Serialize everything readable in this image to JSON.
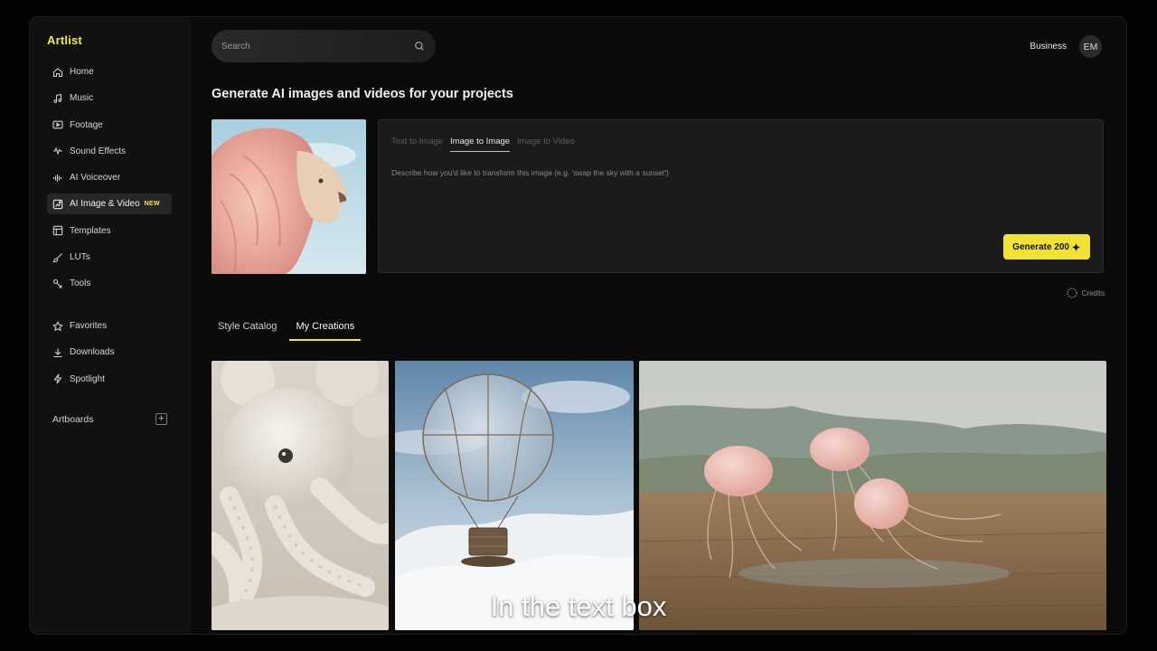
{
  "app": {
    "logo": "Artlist"
  },
  "sidebar": {
    "items": [
      {
        "label": "Home",
        "icon": "home-icon"
      },
      {
        "label": "Music",
        "icon": "music-note-icon"
      },
      {
        "label": "Footage",
        "icon": "play-icon"
      },
      {
        "label": "Sound Effects",
        "icon": "waveform-icon"
      },
      {
        "label": "AI Voiceover",
        "icon": "voice-wave-icon"
      },
      {
        "label": "AI Image & Video",
        "icon": "ai-image-icon",
        "badge": "NEW",
        "active": true
      },
      {
        "label": "Templates",
        "icon": "template-icon"
      },
      {
        "label": "LUTs",
        "icon": "brush-icon"
      },
      {
        "label": "Tools",
        "icon": "tools-icon"
      }
    ],
    "secondary": [
      {
        "label": "Favorites",
        "icon": "star-icon"
      },
      {
        "label": "Downloads",
        "icon": "download-icon"
      },
      {
        "label": "Spotlight",
        "icon": "bolt-icon"
      }
    ],
    "artboards_label": "Artboards"
  },
  "search": {
    "placeholder": "Search"
  },
  "header": {
    "business_label": "Business",
    "avatar_initials": "EM"
  },
  "main": {
    "heading": "Generate AI images and videos for your projects",
    "modes": [
      "Text to Image",
      "Image to Image",
      "Image to Video"
    ],
    "active_mode": "Image to Image",
    "prompt_placeholder": "Describe how you'd like to transform this image (e.g. 'swap the sky with a sunset')",
    "generate_label": "Generate 200",
    "credits_label": "Credits",
    "tabs": [
      "Style Catalog",
      "My Creations"
    ],
    "active_tab": "My Creations"
  },
  "caption": "In the text box",
  "colors": {
    "accent": "#f2e233",
    "logo": "#f2e94e",
    "background": "#0b0b0b",
    "sidebar": "#111111"
  }
}
